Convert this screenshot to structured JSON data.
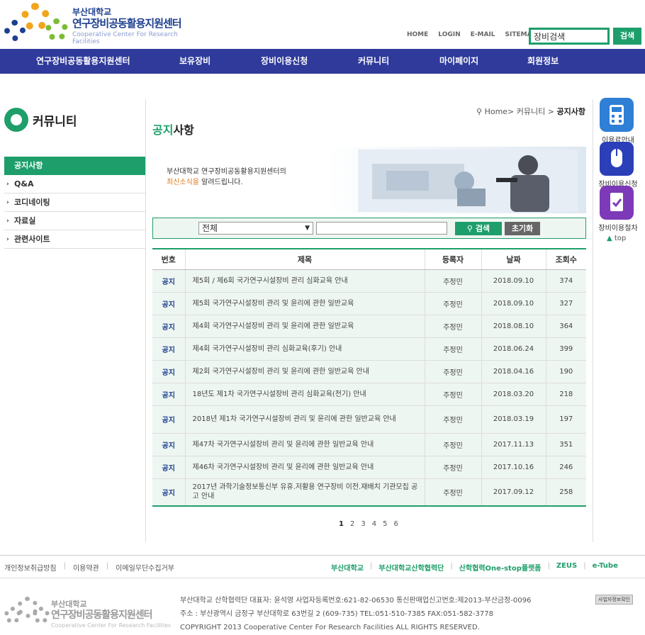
{
  "header": {
    "logo_univ": "부산대학교",
    "logo_name": "연구장비공동활용지원센터",
    "logo_eng": "Cooperative Center For Research Facilities",
    "util_links": [
      "HOME",
      "LOGIN",
      "E-MAIL",
      "SITEMAP"
    ],
    "search_value": "장비검색",
    "search_button": "검색"
  },
  "gnb": [
    "연구장비공동활용지원센터",
    "보유장비",
    "장비이용신청",
    "커뮤니티",
    "마이페이지",
    "회원정보"
  ],
  "sidebar": {
    "title": "커뮤니티",
    "items": [
      {
        "label": "공지사항",
        "active": true
      },
      {
        "label": "Q&A",
        "active": false
      },
      {
        "label": "코디네이팅",
        "active": false
      },
      {
        "label": "자료실",
        "active": false
      },
      {
        "label": "관련사이트",
        "active": false
      }
    ]
  },
  "breadcrumb": {
    "home": "Home>",
    "section": "커뮤니티",
    "sep": ">",
    "current": "공지사항"
  },
  "page_title": {
    "part1": "공지",
    "part2": "사항"
  },
  "banner": {
    "line1": "부산대학교 연구장비공동활용지원센터의",
    "line2_highlight": "최신소식을",
    "line2_rest": " 알려드립니다."
  },
  "search": {
    "select_value": "전체",
    "search_button": "검색",
    "reset_button": "초기화"
  },
  "table": {
    "headers": [
      "번호",
      "제목",
      "등록자",
      "날짜",
      "조회수"
    ],
    "rows": [
      {
        "no": "공지",
        "title": "제5회 / 제6회 국가연구시설장비 관리 심화교육 안내",
        "author": "주정민",
        "date": "2018.09.10",
        "views": "374"
      },
      {
        "no": "공지",
        "title": "제5회 국가연구시설장비 관리 및 윤리에 관한 일반교육",
        "author": "주정민",
        "date": "2018.09.10",
        "views": "327"
      },
      {
        "no": "공지",
        "title": "제4회 국가연구시설장비 관리 및 윤리에 관한 일반교육",
        "author": "주정민",
        "date": "2018.08.10",
        "views": "364"
      },
      {
        "no": "공지",
        "title": "제4회 국가연구시설장비 관리 심화교육(후기) 안내",
        "author": "주정민",
        "date": "2018.06.24",
        "views": "399"
      },
      {
        "no": "공지",
        "title": "제2회 국가연구시설장비 관리 및 윤리에 관한 일반교육 안내",
        "author": "주정민",
        "date": "2018.04.16",
        "views": "190"
      },
      {
        "no": "공지",
        "title": "18년도 제1차 국가연구시설장비 관리 심화교육(전기) 안내",
        "author": "주정민",
        "date": "2018.03.20",
        "views": "218"
      },
      {
        "no": "공지",
        "title": "2018년 제1차 국가연구시설장비 관리 및 윤리에 관한 일반교육 안내",
        "author": "주정민",
        "date": "2018.03.19",
        "views": "197"
      },
      {
        "no": "공지",
        "title": "제47차 국가연구시설장비 관리 및 윤리에 관한 일반교육 안내",
        "author": "주정민",
        "date": "2017.11.13",
        "views": "351"
      },
      {
        "no": "공지",
        "title": "제46차 국가연구시설장비 관리 및 윤리에 관한 일반교육 안내",
        "author": "주정민",
        "date": "2017.10.16",
        "views": "246"
      },
      {
        "no": "공지",
        "title": "2017년 과학기술정보통신부 유휴.저활용 연구장비 이전.재배치 기관모집 공고 안내",
        "author": "주정민",
        "date": "2017.09.12",
        "views": "258"
      }
    ]
  },
  "pagination": [
    "1",
    "2",
    "3",
    "4",
    "5",
    "6"
  ],
  "quick_menu": {
    "items": [
      {
        "label": "이용료안내",
        "icon": "calculator-icon",
        "color": "#2f7fd6"
      },
      {
        "label": "장비이용신청",
        "icon": "mouse-icon",
        "color": "#2b3fb8"
      },
      {
        "label": "장비이용절차",
        "icon": "checklist-icon",
        "color": "#7d3ab8"
      }
    ],
    "top": "top"
  },
  "footer": {
    "links": [
      "개인정보취급방침",
      "이용약관",
      "이메일무단수집거부"
    ],
    "related": [
      "부산대학교",
      "부산대학교산학협력단",
      "산학협력One-stop플랫폼",
      "ZEUS",
      "e-Tube"
    ],
    "info_line1": "부산대학교 산학협력단 대표자: 윤석영   사업자등록번호:621-82-06530   통신판매업신고번호:제2013-부산금정-0096",
    "info_line2": "주소 : 부산광역시 금정구 부산대학로 63번길 2 (609-735)   TEL:051-510-7385   FAX:051-582-3778",
    "info_line3": "COPYRIGHT 2013 Cooperative Center For Research Facilities ALL RIGHTS RESERVED.",
    "badge": "사업자정보확인"
  },
  "colors": {
    "primary_green": "#1e9e6b",
    "nav_blue": "#2f3a9b"
  }
}
